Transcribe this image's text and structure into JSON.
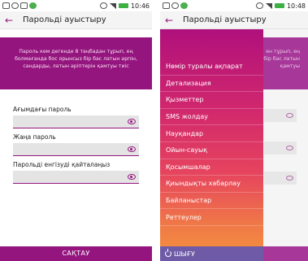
{
  "screens": [
    {
      "status": {
        "time": "10:46"
      },
      "app_bar": {
        "title": "Парольді ауыстыру"
      },
      "info_text": "Пароль кем дегенде 8 таңбадан тұрып, ең болмағанда бос орынсыз бір бас латын әрпін, сандарды, латын әріптерін қамтуы тиіс",
      "fields": [
        {
          "label": "Ағымдағы пароль",
          "value": ""
        },
        {
          "label": "Жаңа пароль",
          "value": ""
        },
        {
          "label": "Парольді енгізуді қайталаңыз",
          "value": ""
        }
      ],
      "save_label": "САҚТАУ"
    },
    {
      "status": {
        "time": "10:48"
      },
      "app_bar": {
        "title": "Парольді ауыстыру"
      },
      "background_text": "ен тұрып, ең\nбір бас латын\nқамтуы",
      "menu": [
        "Нөмір туралы ақпарат",
        "Детализация",
        "Қызметтер",
        "SMS жолдау",
        "Науқандар",
        "Ойын-сауық",
        "Қосымшалар",
        "Қиындықты хабарлау",
        "Байланыстар",
        "Реттеулер"
      ],
      "logout_label": "ШЫҒУ"
    }
  ],
  "colors": {
    "brand_purple": "#95157f",
    "drawer_gradient_top": "#b0107c",
    "drawer_gradient_bottom": "#f4943c",
    "logout_bar": "#6e5aa6"
  },
  "icons": [
    "back-arrow-icon",
    "eye-icon",
    "power-icon",
    "battery-icon",
    "signal-icon",
    "alarm-icon"
  ]
}
